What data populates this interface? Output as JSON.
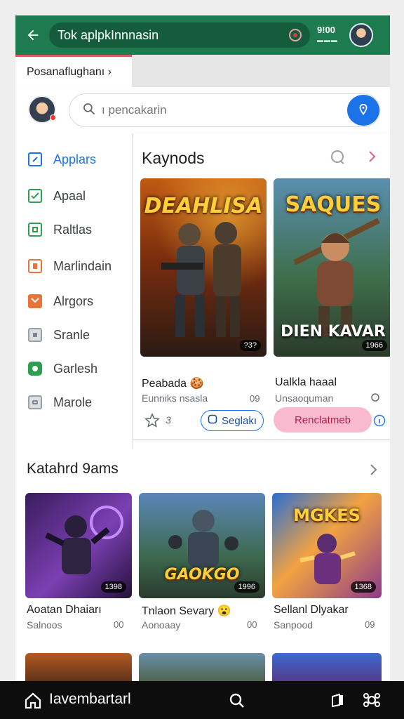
{
  "appbar": {
    "url_text": "Tok aplpkInnnasin",
    "ticker_value": "9!00",
    "icons": [
      "back-arrow-icon",
      "record-icon",
      "avatar"
    ]
  },
  "breadcrumb": {
    "tab_label": "Posanaflughanı ›"
  },
  "search": {
    "placeholder": "ı pencakarin"
  },
  "sidebar": {
    "items": [
      {
        "label": "Applars",
        "color": "#1a73e8"
      },
      {
        "label": "Apaal",
        "color": "#2e9e4f"
      },
      {
        "label": "Raltlas",
        "color": "#2e9e4f"
      },
      {
        "label": "Marlindain",
        "color": "#e8743b"
      },
      {
        "label": "Alrgors",
        "color": "#e8743b"
      },
      {
        "label": "Sranle",
        "color": "#9aa0a6"
      },
      {
        "label": "Garlesh",
        "color": "#2e9e4f"
      },
      {
        "label": "Marole",
        "color": "#9aa0a6"
      }
    ]
  },
  "featured": {
    "title": "Kaynods",
    "games": [
      {
        "art_title": "DEAHLISA",
        "badge": "?3?",
        "name": "Peabada 🍪",
        "sub": "Eunniks nsasla",
        "count": "09"
      },
      {
        "art_title": "SAQUES",
        "art_title2": "DIEN KAVAR",
        "badge": "1966",
        "name": "Ualkla haaal",
        "sub": "Unsaoquman",
        "count": ""
      }
    ],
    "actions": {
      "star_count": "3",
      "outline_label": "Seglakı",
      "pink_label": "Renclatmeb"
    }
  },
  "section": {
    "title": "Katahrd 9ams",
    "games": [
      {
        "badge": "1398",
        "name": "Aoatan Dhaiarı",
        "sub": "Salnoos",
        "count": "00"
      },
      {
        "art_title": "GAOKGO",
        "badge": "1996",
        "name": "Tnlaon Sevary 😮",
        "sub": "Aonoaay",
        "count": "00"
      },
      {
        "art_title": "MGKES",
        "badge": "1368",
        "name": "Sellanl Dlyakar",
        "sub": "Sanpood",
        "count": "09"
      }
    ]
  },
  "bottombar": {
    "label": "Iavembartarl"
  },
  "colors": {
    "appbar": "#1e7a4f",
    "accent": "#1a73e8",
    "pink": "#f9b9cf"
  }
}
